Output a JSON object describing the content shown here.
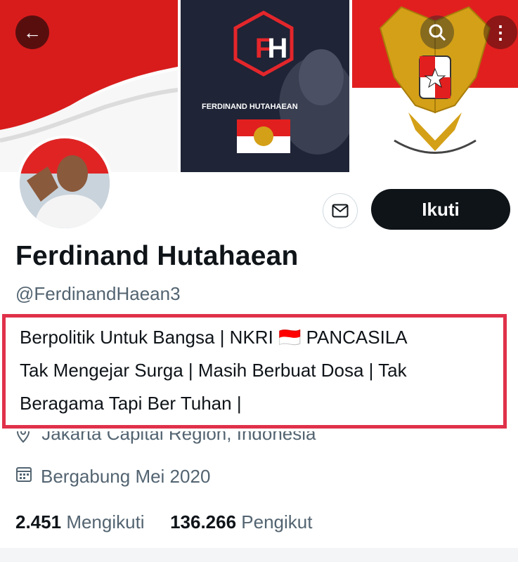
{
  "header": {
    "back_icon": "arrow-left-icon",
    "search_icon": "search-icon",
    "more_icon": "more-vertical-icon"
  },
  "banner": {
    "logo_text": "FH",
    "logo_name": "FERDINAND HUTAHAEAN",
    "colors": {
      "red": "#e11f1f",
      "dark": "#1e2233",
      "gold": "#d4a017"
    }
  },
  "profile": {
    "display_name": "Ferdinand Hutahaean",
    "handle": "@FerdinandHaean3",
    "bio_lines": [
      "Berpolitik Untuk Bangsa | NKRI 🇮🇩 PANCASILA",
      "Tak Mengejar Surga | Masih Berbuat Dosa | Tak",
      "Beragama Tapi Ber Tuhan |"
    ],
    "location": "Jakarta Capital Region, Indonesia",
    "joined": "Bergabung Mei 2020"
  },
  "actions": {
    "follow_label": "Ikuti",
    "message_icon": "mail-icon"
  },
  "stats": {
    "following_count": "2.451",
    "following_label": "Mengikuti",
    "followers_count": "136.266",
    "followers_label": "Pengikut"
  },
  "highlight_color": "#e0314a"
}
